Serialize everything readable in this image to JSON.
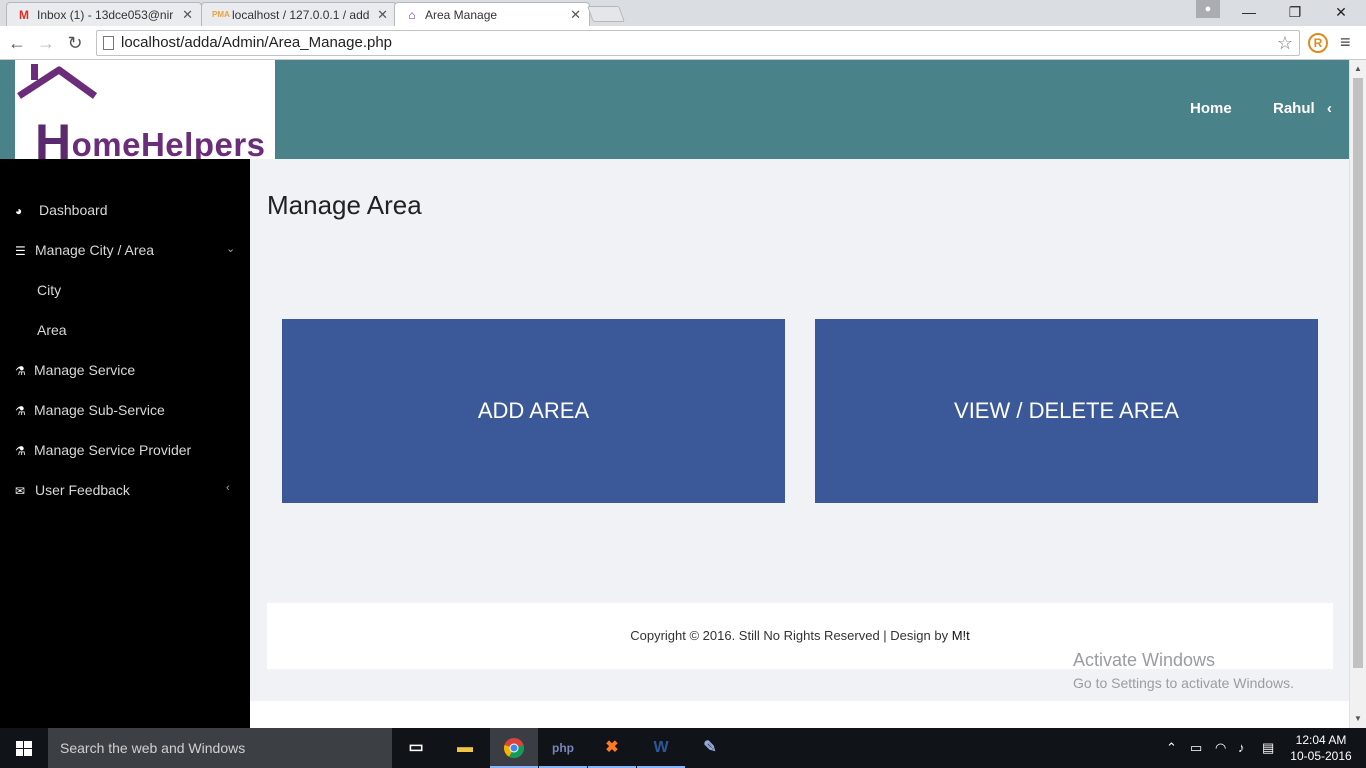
{
  "browser": {
    "tabs": [
      {
        "title": "Inbox (1) - 13dce053@nir",
        "favicon": "gmail-icon",
        "active": false
      },
      {
        "title": "localhost / 127.0.0.1 / add",
        "favicon": "phpmyadmin-icon",
        "active": false
      },
      {
        "title": "Area Manage",
        "favicon": "homehelpers-icon",
        "active": true
      }
    ],
    "url": "localhost/adda/Admin/Area_Manage.php"
  },
  "header": {
    "logo_text": "HomeHelpers",
    "nav": {
      "home": "Home",
      "user": "Rahul"
    }
  },
  "sidebar": {
    "items": [
      {
        "label": "Dashboard",
        "icon": "dashboard-icon"
      },
      {
        "label": "Manage City / Area",
        "icon": "list-icon"
      },
      {
        "label": "City",
        "icon": ""
      },
      {
        "label": "Area",
        "icon": ""
      },
      {
        "label": "Manage Service",
        "icon": "flask-icon"
      },
      {
        "label": "Manage Sub-Service",
        "icon": "flask-icon"
      },
      {
        "label": "Manage Service Provider",
        "icon": "flask-icon"
      },
      {
        "label": "User Feedback",
        "icon": "envelope-icon"
      }
    ]
  },
  "main": {
    "title": "Manage Area",
    "buttons": {
      "add": "ADD AREA",
      "view": "VIEW / DELETE AREA"
    }
  },
  "footer": {
    "text": "Copyright © 2016. Still No Rights Reserved | Design by ",
    "brand": "M!t"
  },
  "watermark": {
    "line1": "Activate Windows",
    "line2": "Go to Settings to activate Windows."
  },
  "taskbar": {
    "search_placeholder": "Search the web and Windows",
    "time": "12:04 AM",
    "date": "10-05-2016"
  },
  "colors": {
    "topbar": "#4a8289",
    "button": "#3b5998",
    "sidebar": "#000000",
    "logo": "#6b2d7a"
  }
}
